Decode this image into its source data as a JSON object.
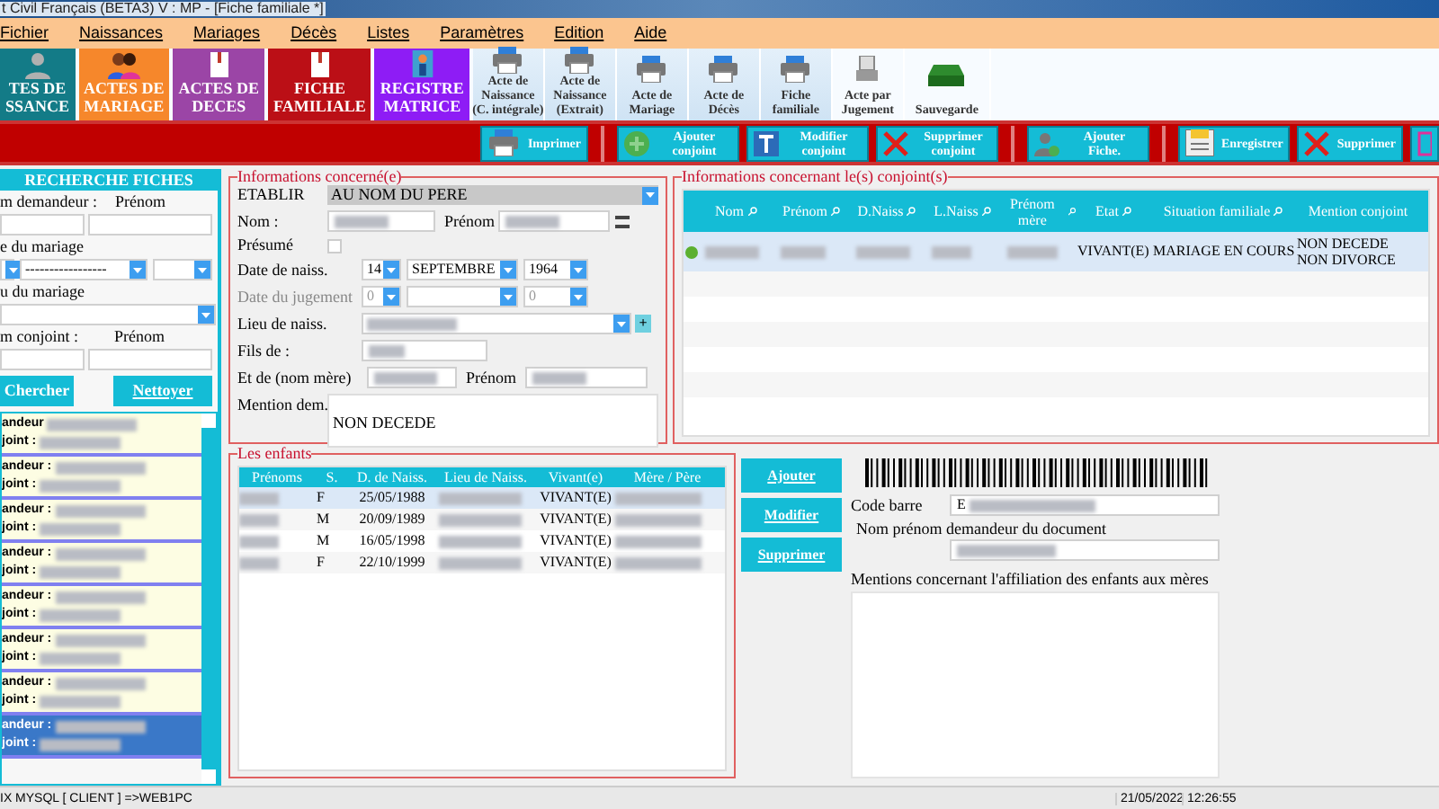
{
  "window": {
    "title": "t Civil Français (BETA3)  V : MP  - [Fiche familiale *]"
  },
  "menu": [
    "Fichier",
    "Naissances",
    "Mariages",
    "Décès",
    "Listes",
    "Paramètres",
    "Edition",
    "Aide"
  ],
  "tiles": [
    {
      "lines": [
        "TES DE",
        "SSANCE"
      ],
      "color": "#137b87",
      "kind": "person"
    },
    {
      "lines": [
        "ACTES DE",
        "MARIAGE"
      ],
      "color": "#f6872b",
      "kind": "couple"
    },
    {
      "lines": [
        "ACTES DE",
        "DECES"
      ],
      "color": "#9b45a6",
      "kind": "book"
    },
    {
      "lines": [
        "FICHE",
        "FAMILIALE"
      ],
      "color": "#bb0f16",
      "kind": "book"
    },
    {
      "lines": [
        "REGISTRE",
        "MATRICE"
      ],
      "color": "#8e1cf5",
      "kind": "register"
    }
  ],
  "print_buttons": [
    {
      "lines": [
        "Acte de",
        "Naissance",
        "(C. intégrale)"
      ],
      "kind": "printer"
    },
    {
      "lines": [
        "Acte de",
        "Naissance",
        "(Extrait)"
      ],
      "kind": "printer"
    },
    {
      "lines": [
        "Acte de",
        "Mariage"
      ],
      "kind": "printer"
    },
    {
      "lines": [
        "Acte de",
        "Décès"
      ],
      "kind": "printer"
    },
    {
      "lines": [
        "Fiche",
        "familiale"
      ],
      "kind": "printer"
    },
    {
      "lines": [
        "Acte par",
        "Jugement"
      ],
      "kind": "scanner"
    },
    {
      "lines": [
        "Sauvegarde"
      ],
      "kind": "drive"
    }
  ],
  "action_groups": [
    [
      {
        "label": "Imprimer",
        "kind": "print"
      }
    ],
    [
      {
        "label": "Ajouter conjoint",
        "kind": "add"
      },
      {
        "label": "Modifier conjoint",
        "kind": "edit"
      },
      {
        "label": "Supprimer conjoint",
        "kind": "delete"
      }
    ],
    [
      {
        "label": "Ajouter Fiche.",
        "kind": "person"
      }
    ],
    [
      {
        "label": "Enregistrer",
        "kind": "save"
      },
      {
        "label": "Supprimer",
        "kind": "delete"
      },
      {
        "kind": "grid"
      }
    ]
  ],
  "search": {
    "title": "RECHERCHE FICHES",
    "demandeur_label": "m demandeur :",
    "prenom_label": "Prénom",
    "date_label": "e du mariage",
    "date_placeholder": "-----------------",
    "lieu_label": "u du mariage",
    "conjoint_label": "m conjoint :",
    "prenom2_label": "Prénom",
    "search_button": "Chercher",
    "clear_button": "Nettoyer"
  },
  "results": [
    {
      "line1": "andeur",
      "line2": "joint :",
      "selected": false
    },
    {
      "line1": "andeur :",
      "line2": "joint :",
      "selected": false
    },
    {
      "line1": "andeur :",
      "line2": "joint :",
      "selected": false
    },
    {
      "line1": "andeur :",
      "line2": "joint :",
      "selected": false
    },
    {
      "line1": "andeur :",
      "line2": "joint :",
      "selected": false
    },
    {
      "line1": "andeur :",
      "line2": "joint :",
      "selected": false
    },
    {
      "line1": "andeur :",
      "line2": "joint :",
      "selected": false
    },
    {
      "line1": "andeur :",
      "line2": "joint :",
      "selected": true
    }
  ],
  "person": {
    "legend": "Informations concerné(e)",
    "etablir_label": "ETABLIR",
    "etablir_value": "AU NOM DU PERE",
    "nom_label": "Nom :",
    "prenom_label": "Prénom",
    "presume_label": "Présumé",
    "presume_checked": false,
    "date_label": "Date de naiss.",
    "day": "14",
    "month": "SEPTEMBRE",
    "year": "1964",
    "jugement_label": "Date du jugement",
    "j_day": "0",
    "j_year": "0",
    "lieu_label": "Lieu de naiss.",
    "add_symbol": "+",
    "fils_label": "Fils de :",
    "mere_label": "Et de (nom mère)",
    "mere_prenom_label": "Prénom",
    "mention_label": "Mention dem.",
    "mention_value": "NON DECEDE"
  },
  "spouses": {
    "legend": "Informations concernant le(s) conjoint(s)",
    "columns": [
      "Nom",
      "Prénom",
      "D.Naiss",
      "L.Naiss",
      "Prénom mère",
      "Etat",
      "Situation familiale",
      "Mention conjoint"
    ],
    "rows": [
      {
        "etat": "VIVANT(E)",
        "situation": "MARIAGE EN COURS",
        "mention": [
          "NON DECEDE",
          "NON DIVORCE"
        ],
        "selected": true
      }
    ]
  },
  "children": {
    "legend": "Les enfants",
    "columns": [
      "Prénoms",
      "S.",
      "D. de Naiss.",
      "Lieu de Naiss.",
      "Vivant(e)",
      "Mère / Père"
    ],
    "rows": [
      {
        "sex": "F",
        "date": "25/05/1988",
        "status": "VIVANT(E)",
        "selected": true
      },
      {
        "sex": "M",
        "date": "20/09/1989",
        "status": "VIVANT(E)",
        "selected": false
      },
      {
        "sex": "M",
        "date": "16/05/1998",
        "status": "VIVANT(E)",
        "selected": false
      },
      {
        "sex": "F",
        "date": "22/10/1999",
        "status": "VIVANT(E)",
        "selected": false
      }
    ]
  },
  "child_buttons": [
    "Ajouter",
    "Modifier",
    "Supprimer"
  ],
  "document": {
    "barcode_label": "Code barre",
    "barcode_value": "E",
    "requester_label": "Nom prénom demandeur du document",
    "mentions_label": "Mentions concernant l'affiliation des enfants aux mères"
  },
  "status_bar": {
    "connection": "IX MYSQL [ CLIENT ] =>WEB1PC",
    "date": "21/05/2022",
    "time": "12:26:55"
  }
}
